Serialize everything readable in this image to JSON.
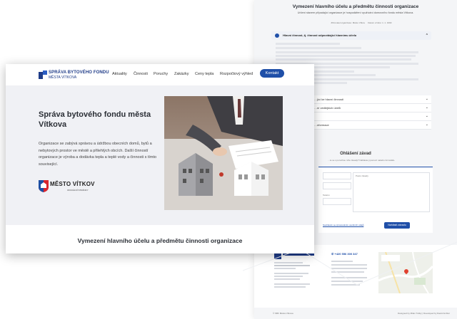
{
  "front": {
    "logo": {
      "line1": "SPRÁVA BYTOVÉHO FONDU",
      "line2": "MĚSTA VÍTKOVA"
    },
    "nav": [
      "Aktuality",
      "Činnosti",
      "Poruchy",
      "Zakázky",
      "Ceny tepla",
      "Rozpočtový výhled"
    ],
    "contact_button": "Kontakt",
    "hero": {
      "title": "Správa bytového fondu města Vítkova",
      "paragraph": "Organizace se zabývá správou a údržbou obecních domů, bytů a nebytových prostor ve městě a přilehlých obcích. Další činností organizace je výroba a dodávka tepla a teplé vody a činnosti s tímto související.",
      "city_name": "MĚSTO VÍTKOV",
      "city_sub": "OFICIÁLNÍ STRÁNKY"
    },
    "section_title": "Vymezení hlavního účelu a předmětu činnosti organizace"
  },
  "back": {
    "title": "Vymezení hlavního účelu a předmětu činnosti organizace",
    "subtitle": "Určení stavem připadající organizace je hospodáření využívání domovního fondu města Vítkova.",
    "meta_left": "Zřizovatel organizace: Město Vítkov",
    "meta_right": "Datum vzniku: 1. 1. 1993",
    "accordion_first": "Hlavní činnost, tj. činnost odpovídající hlavnímu účelu",
    "accordion_rows": [
      "…jící ke hlavní činnosti",
      "…ní vedlejších účelů",
      "",
      "",
      "…nformace"
    ],
    "form_title": "Ohlášení závad",
    "form_sub": "…te se s poruchou níže závady? Nahlaste ji pomocí našeho formuláře.",
    "form_labels": {
      "message": "Popis závady",
      "phone": "Telefon"
    },
    "form_link": "Souhlasím se zpracováním osobních údajů",
    "send_button": "Nahlásit závadu",
    "phone": "+420 556 300 347",
    "footer_copy": "© SBF Města Vítkova",
    "footer_credit": "Designed by Milan Tušký | Developed by David Ambler"
  }
}
